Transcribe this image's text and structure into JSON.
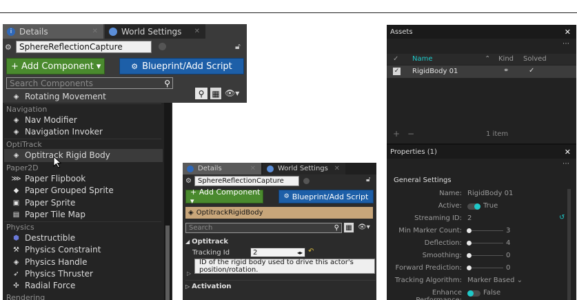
{
  "panel1": {
    "tabs": [
      {
        "label": "Details",
        "icon": "info-icon"
      },
      {
        "label": "World Settings",
        "icon": "globe-icon"
      }
    ],
    "object_name": "SphereReflectionCapture",
    "add_component_label": "+ Add Component ▾",
    "blueprint_label": "Blueprint/Add Script",
    "search_placeholder": "Search Components",
    "items": {
      "rotating_movement": "Rotating Movement",
      "nav_header": "Navigation",
      "nav_modifier": "Nav Modifier",
      "navigation_invoker": "Navigation Invoker",
      "optitrack_header": "OptiTrack",
      "optitrack_rigid_body": "Optitrack Rigid Body",
      "paper2d_header": "Paper2D",
      "paper_flipbook": "Paper Flipbook",
      "paper_grouped_sprite": "Paper Grouped Sprite",
      "paper_sprite": "Paper Sprite",
      "paper_tile_map": "Paper Tile Map",
      "physics_header": "Physics",
      "destructible": "Destructible",
      "physics_constraint": "Physics Constraint",
      "physics_handle": "Physics Handle",
      "physics_thruster": "Physics Thruster",
      "radial_force": "Radial Force",
      "rendering_header": "Rendering"
    }
  },
  "panel2": {
    "tabs": [
      {
        "label": "Details",
        "icon": "info-icon"
      },
      {
        "label": "World Settings",
        "icon": "globe-icon"
      }
    ],
    "object_name": "SphereReflectionCapture",
    "add_component_label": "+ Add Component ▾",
    "blueprint_label": "Blueprint/Add Script",
    "component_name": "OptitrackRigidBody",
    "search_placeholder": "Search",
    "section_optitrack": "Optitrack",
    "tracking_id_label": "Tracking Id",
    "tracking_id_value": "2",
    "tooltip": "ID of the rigid body used to drive this actor's position/rotation.",
    "section_activation": "Activation"
  },
  "panel3": {
    "assets": {
      "title": "Assets",
      "columns": {
        "name": "Name",
        "kind": "Kind",
        "solved": "Solved"
      },
      "rows": [
        {
          "name": "RigidBody 01",
          "checked": true,
          "solved": "✓"
        }
      ],
      "add": "+",
      "remove": "−",
      "count": "1 item"
    },
    "properties": {
      "title": "Properties (1)",
      "section": "General Settings",
      "name_label": "Name:",
      "name_value": "RigidBody 01",
      "active_label": "Active:",
      "active_value": "True",
      "active_on": true,
      "streaming_label": "Streaming ID:",
      "streaming_value": "2",
      "min_marker_label": "Min Marker Count:",
      "min_marker_value": "3",
      "deflection_label": "Deflection:",
      "deflection_value": "4",
      "smoothing_label": "Smoothing:",
      "smoothing_value": "0",
      "forward_label": "Forward Prediction:",
      "forward_value": "0",
      "algo_label": "Tracking Algorithm:",
      "algo_value": "Marker Based ⌄",
      "enhance_label": "Enhance Performance:",
      "enhance_value": "False",
      "enhance_on": false
    }
  },
  "colors": {
    "accent_teal": "#1fc9c9",
    "add_green": "#4a8a2e",
    "blueprint_blue": "#1d5fa8",
    "component_tan": "#c8a67a"
  }
}
